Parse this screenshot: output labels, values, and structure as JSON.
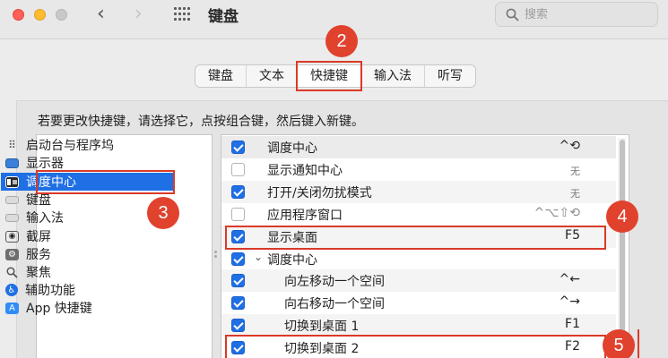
{
  "window": {
    "title": "键盘",
    "nav_back": "‹",
    "nav_forward": "›"
  },
  "search": {
    "placeholder": "搜索",
    "value": ""
  },
  "tabs": [
    {
      "label": "键盘",
      "active": false
    },
    {
      "label": "文本",
      "active": false
    },
    {
      "label": "快捷键",
      "active": true
    },
    {
      "label": "输入法",
      "active": false
    },
    {
      "label": "听写",
      "active": false
    }
  ],
  "instruction": "若要更改快捷键，请选择它，点按组合键，然后键入新键。",
  "categories": [
    {
      "label": "启动台与程序坞",
      "icon": "launchpad-icon",
      "selected": false
    },
    {
      "label": "显示器",
      "icon": "display-icon",
      "selected": false
    },
    {
      "label": "调度中心",
      "icon": "mission-control-icon",
      "selected": true
    },
    {
      "label": "键盘",
      "icon": "keyboard-icon",
      "selected": false
    },
    {
      "label": "输入法",
      "icon": "input-method-icon",
      "selected": false
    },
    {
      "label": "截屏",
      "icon": "screenshot-icon",
      "selected": false
    },
    {
      "label": "服务",
      "icon": "services-icon",
      "selected": false
    },
    {
      "label": "聚焦",
      "icon": "spotlight-icon",
      "selected": false
    },
    {
      "label": "辅助功能",
      "icon": "accessibility-icon",
      "selected": false
    },
    {
      "label": "App 快捷键",
      "icon": "app-store-icon",
      "selected": false
    }
  ],
  "shortcuts": [
    {
      "checked": true,
      "label": "调度中心",
      "key": "^⟲",
      "indent": 0
    },
    {
      "checked": false,
      "label": "显示通知中心",
      "key": "无",
      "indent": 0
    },
    {
      "checked": true,
      "label": "打开/关闭勿扰模式",
      "key": "无",
      "indent": 0
    },
    {
      "checked": false,
      "label": "应用程序窗口",
      "key": "^⌥⇧⟲",
      "indent": 0
    },
    {
      "checked": true,
      "label": "显示桌面",
      "key": "F5",
      "indent": 0
    },
    {
      "checked": true,
      "label": "调度中心",
      "key": "",
      "indent": 0,
      "group": true
    },
    {
      "checked": true,
      "label": "向左移动一个空间",
      "key": "^←",
      "indent": 1
    },
    {
      "checked": true,
      "label": "向右移动一个空间",
      "key": "^→",
      "indent": 1
    },
    {
      "checked": true,
      "label": "切换到桌面 1",
      "key": "F1",
      "indent": 1
    },
    {
      "checked": true,
      "label": "切换到桌面 2",
      "key": "F2",
      "indent": 1
    }
  ],
  "badges": [
    "2",
    "3",
    "4",
    "5"
  ],
  "colors": {
    "accent": "#1f6fe5",
    "annotation": "#e0422e"
  }
}
